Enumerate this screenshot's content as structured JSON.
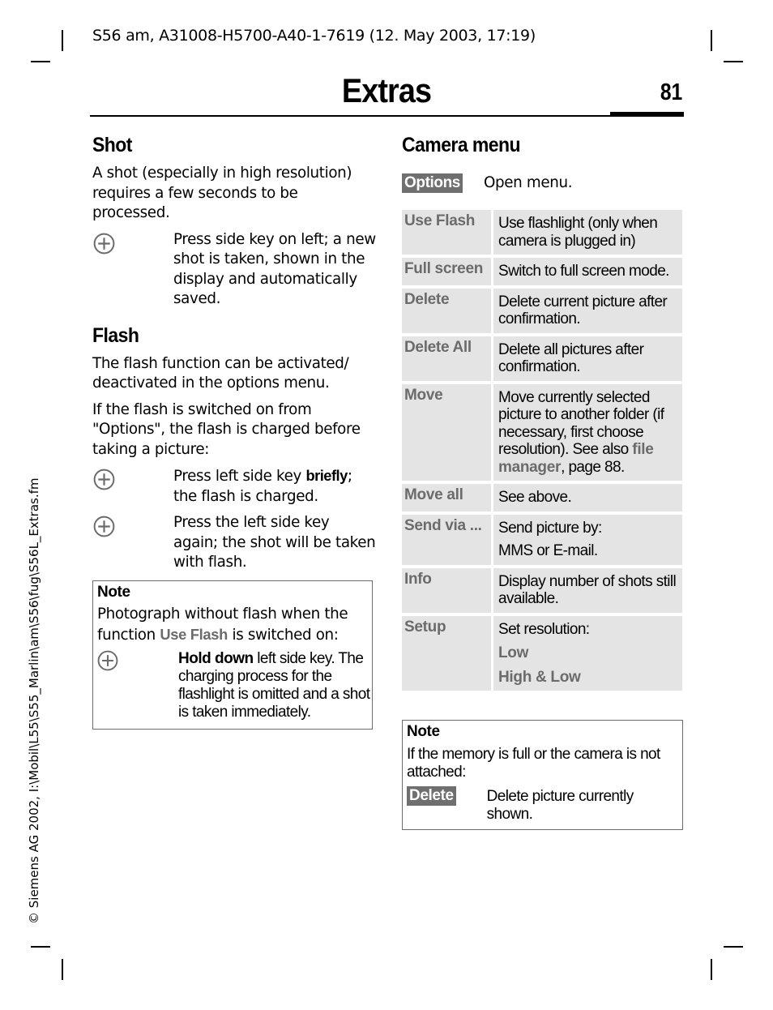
{
  "header": {
    "doc_line": "S56 am, A31008-H5700-A40-1-7619 (12. May 2003, 17:19)",
    "chapter_title": "Extras",
    "page_number": "81"
  },
  "side_text": "© Siemens AG 2002, I:\\Mobil\\L55\\S55_Marlin\\am\\S56\\fug\\S56L_Extras.fm",
  "shot": {
    "heading": "Shot",
    "intro": "A shot (especially in high resolution) requires a few seconds to be processed.",
    "step": "Press side key on left; a new shot is taken, shown in the display and automatically saved."
  },
  "flash": {
    "heading": "Flash",
    "para1": "The flash function can be activated/ deactivated in the options menu.",
    "para2": "If the flash is switched on from \"Options\", the flash is charged before taking a picture:",
    "step1_pre": "Press left side key ",
    "step1_bold": "briefly",
    "step1_post": "; the flash is charged.",
    "step2": "Press the left side key again; the shot will be taken with flash."
  },
  "note_left": {
    "title": "Note",
    "text_pre": "Photograph without flash when the function ",
    "text_ref": "Use Flash",
    "text_post": " is switched on:",
    "step_bold": "Hold down",
    "step_text": " left side key. The charging process for the flashlight is omitted and a shot is taken immediately."
  },
  "camera_menu": {
    "heading": "Camera menu",
    "options_key": "Options",
    "options_desc": "Open menu.",
    "items": [
      {
        "name": "Use Flash",
        "desc": "Use flashlight (only when camera is plugged in)"
      },
      {
        "name": "Full screen",
        "desc": "Switch to full screen mode."
      },
      {
        "name": "Delete",
        "desc": "Delete current picture after confirmation."
      },
      {
        "name": "Delete All",
        "desc": "Delete all pictures after confirmation."
      },
      {
        "name": "Move",
        "desc_pre": "Move currently selected picture to another folder (if necessary, first choose resolution). See also ",
        "desc_ref": "file manager",
        "desc_post": ", page 88."
      },
      {
        "name": "Move all",
        "desc": "See above."
      },
      {
        "name": "Send via ...",
        "desc_line1": "Send picture by:",
        "desc_line2": "MMS or E-mail."
      },
      {
        "name": "Info",
        "desc": "Display number of shots still available."
      },
      {
        "name": "Setup",
        "desc": "Set resolution:",
        "options": [
          "Low",
          "High & Low"
        ]
      }
    ]
  },
  "note_right": {
    "title": "Note",
    "text": "If the memory is full or the camera is not attached:",
    "key": "Delete",
    "key_desc": "Delete picture currently shown."
  }
}
